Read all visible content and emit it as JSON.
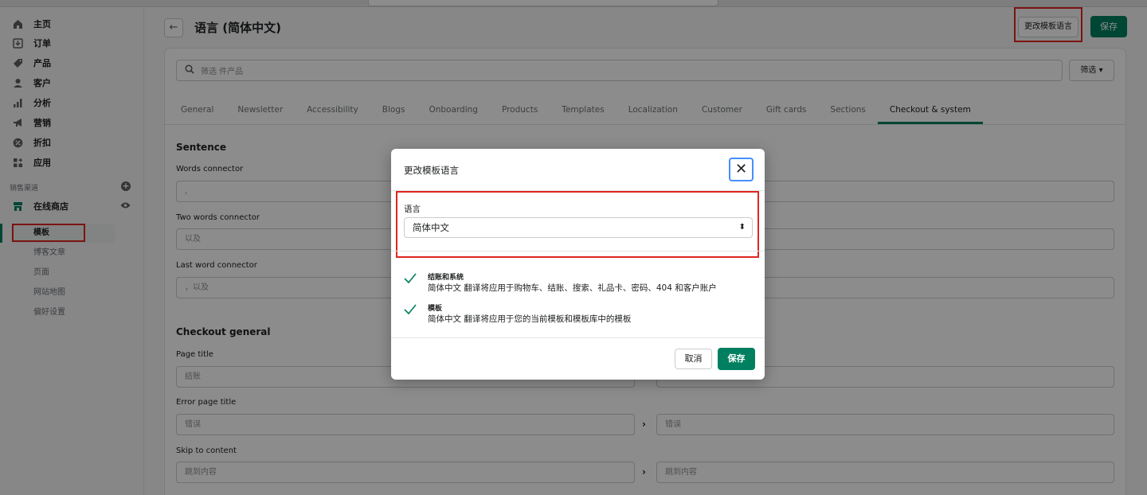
{
  "nav": {
    "items": [
      {
        "label": "主页",
        "icon": "home-icon"
      },
      {
        "label": "订单",
        "icon": "orders-icon"
      },
      {
        "label": "产品",
        "icon": "tag-icon"
      },
      {
        "label": "客户",
        "icon": "person-icon"
      },
      {
        "label": "分析",
        "icon": "bar-chart-icon"
      },
      {
        "label": "营销",
        "icon": "megaphone-icon"
      },
      {
        "label": "折扣",
        "icon": "discount-icon"
      },
      {
        "label": "应用",
        "icon": "apps-icon"
      }
    ],
    "sales_channels_title": "销售渠道",
    "online_store": "在线商店",
    "sub_items": [
      "模板",
      "博客文章",
      "页面",
      "网站地图",
      "偏好设置"
    ]
  },
  "header": {
    "title": "语言 (简体中文)",
    "change_language_button": "更改模板语言",
    "save_button": "保存"
  },
  "filters": {
    "search_placeholder": "筛选 件产品",
    "filter_button": "筛选"
  },
  "tabs": [
    "General",
    "Newsletter",
    "Accessibility",
    "Blogs",
    "Onboarding",
    "Products",
    "Templates",
    "Localization",
    "Customer",
    "Gift cards",
    "Sections",
    "Checkout & system"
  ],
  "active_tab": "Checkout & system",
  "sections": {
    "sentence": {
      "title": "Sentence",
      "fields": [
        {
          "label": "Words connector",
          "value": ","
        },
        {
          "label": "Two words connector",
          "value": "以及"
        },
        {
          "label": "Last word connector",
          "value": "，以及"
        }
      ]
    },
    "checkout_general": {
      "title": "Checkout general",
      "fields": [
        {
          "label": "Page title",
          "value": "结账",
          "translation": ""
        },
        {
          "label": "Error page title",
          "value": "错误",
          "translation": "错误"
        },
        {
          "label": "Skip to content",
          "value": "跳到内容",
          "translation": "跳到内容"
        }
      ]
    }
  },
  "modal": {
    "title": "更改模板语言",
    "language_label": "语言",
    "language_value": "简体中文",
    "checks": [
      {
        "title": "结账和系统",
        "desc": "简体中文 翻译将应用于购物车、结账、搜索、礼品卡、密码、404 和客户账户"
      },
      {
        "title": "模板",
        "desc": "简体中文 翻译将应用于您的当前模板和模板库中的模板"
      }
    ],
    "cancel_button": "取消",
    "save_button": "保存"
  },
  "colors": {
    "accent": "#008060",
    "highlight": "#e0261f",
    "focus": "#458fff"
  }
}
